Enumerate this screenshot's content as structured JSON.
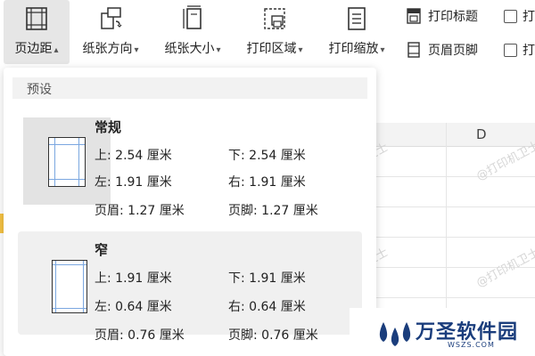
{
  "ribbon": {
    "margins_label": "页边距",
    "orientation_label": "纸张方向",
    "size_label": "纸张大小",
    "print_area_label": "打印区域",
    "print_scale_label": "打印缩放",
    "print_titles_label": "打印标题",
    "header_footer_label": "页眉页脚",
    "check1_label": "打",
    "check2_label": "打"
  },
  "sheet": {
    "column_d": "D"
  },
  "watermark": "@打印机卫士",
  "dropdown": {
    "section_label": "预设",
    "presets": [
      {
        "title": "常规",
        "top": "上: 2.54 厘米",
        "bottom": "下: 2.54 厘米",
        "left": "左: 1.91 厘米",
        "right": "右: 1.91 厘米",
        "header": "页眉: 1.27 厘米",
        "footer": "页脚: 1.27 厘米"
      },
      {
        "title": "窄",
        "top": "上: 1.91 厘米",
        "bottom": "下: 1.91 厘米",
        "left": "左: 0.64 厘米",
        "right": "右: 0.64 厘米",
        "header": "页眉: 0.76 厘米",
        "footer": "页脚: 0.76 厘米"
      }
    ]
  },
  "logo": {
    "name": "万圣软件园",
    "site": "WSZS.COM"
  },
  "colors": {
    "accent_blue": "#1a3d7c",
    "margin_guide": "#7ba7e0",
    "cell_highlight": "#f6c343"
  }
}
